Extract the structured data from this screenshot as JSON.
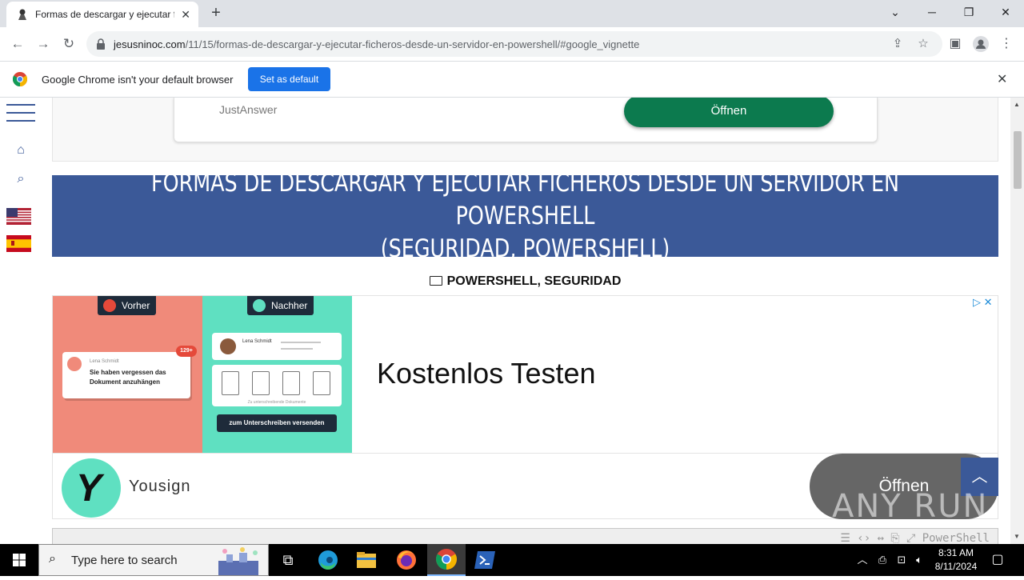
{
  "browser": {
    "tab_title": "Formas de descargar y ejecutar f",
    "url_host": "jesusninoc.com",
    "url_path": "/11/15/formas-de-descargar-y-ejecutar-ficheros-desde-un-servidor-en-powershell/#google_vignette"
  },
  "infobar": {
    "message": "Google Chrome isn't your default browser",
    "button": "Set as default"
  },
  "ad_top": {
    "brand": "JustAnswer",
    "button": "Öffnen"
  },
  "article": {
    "title_line1": "FORMAS DE DESCARGAR Y EJECUTAR FICHEROS DESDE UN SERVIDOR EN POWERSHELL",
    "title_line2": "(SEGURIDAD, POWERSHELL)",
    "categories": "POWERSHELL, SEGURIDAD"
  },
  "ad_main": {
    "before_label": "Vorher",
    "after_label": "Nachher",
    "mail_sender": "Lena Schmidt",
    "mail_text": "Sie haben vergessen das Dokument anzuhängen",
    "mail_badge": "129+",
    "signer_name": "Lena Schmidt",
    "docs_caption": "Zu unterschreibende Dokumente",
    "send_button": "zum Unterschreiben versenden",
    "headline": "Kostenlos Testen",
    "brand": "Yousign",
    "logo_letter": "Y",
    "button": "Öffnen"
  },
  "codebox": {
    "label": "PowerShell"
  },
  "watermark": "ANY RUN",
  "taskbar": {
    "search_placeholder": "Type here to search",
    "time": "8:31 AM",
    "date": "8/11/2024"
  },
  "colors": {
    "brand_blue": "#3b5998",
    "chrome_blue": "#1a73e8",
    "justanswer_green": "#0c7a4e",
    "yousign_teal": "#5fe0c1",
    "yousign_coral": "#f08a7a"
  }
}
